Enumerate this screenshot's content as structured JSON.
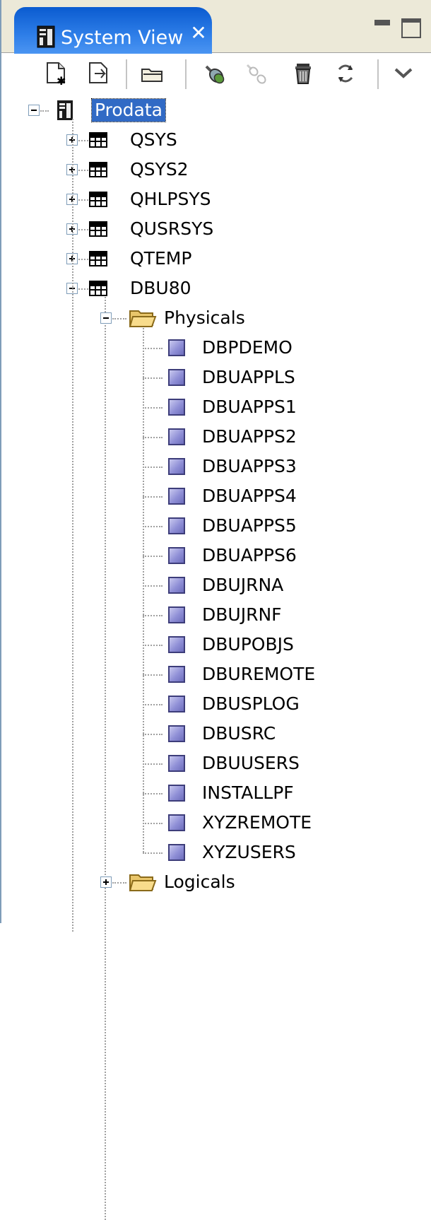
{
  "view": {
    "title": "System View",
    "close_glyph": "✕"
  },
  "toolbar": {
    "icons": [
      "new-filter-pool-icon",
      "new-filter-icon",
      "open-folder-icon",
      "connect-icon",
      "disconnect-icon",
      "delete-icon",
      "refresh-icon",
      "view-menu-chevron-icon"
    ]
  },
  "tree": {
    "root": {
      "label": "Prodata",
      "expanded": true,
      "selected": true
    },
    "libraries": [
      {
        "label": "QSYS",
        "expanded": false
      },
      {
        "label": "QSYS2",
        "expanded": false
      },
      {
        "label": "QHLPSYS",
        "expanded": false
      },
      {
        "label": "QUSRSYS",
        "expanded": false
      },
      {
        "label": "QTEMP",
        "expanded": false
      },
      {
        "label": "DBU80",
        "expanded": true
      }
    ],
    "physicals": {
      "label": "Physicals",
      "expanded": true,
      "files": [
        "DBPDEMO",
        "DBUAPPLS",
        "DBUAPPS1",
        "DBUAPPS2",
        "DBUAPPS3",
        "DBUAPPS4",
        "DBUAPPS5",
        "DBUAPPS6",
        "DBUJRNA",
        "DBUJRNF",
        "DBUPOBJS",
        "DBUREMOTE",
        "DBUSPLOG",
        "DBUSRC",
        "DBUUSERS",
        "INSTALLPF",
        "XYZREMOTE",
        "XYZUSERS"
      ]
    },
    "logicals": {
      "label": "Logicals",
      "expanded": false
    }
  },
  "colors": {
    "tab_active": "#2e7ee8",
    "selection": "#316ac5",
    "file_icon": "#8f8fd6",
    "tree_lines": "#a0a0a0"
  }
}
